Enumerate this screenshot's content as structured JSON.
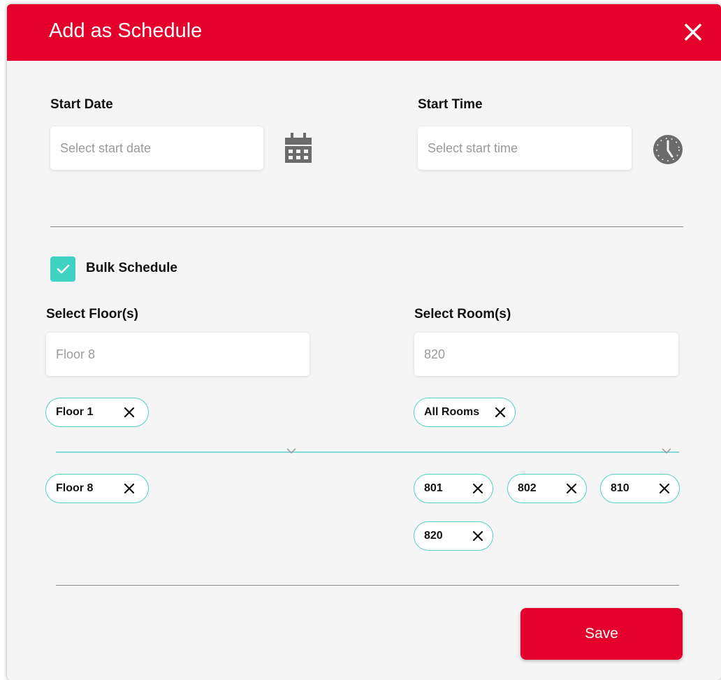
{
  "header": {
    "title": "Add as Schedule",
    "close_icon": "close-icon",
    "color": "#e4002b"
  },
  "start_date": {
    "label": "Start Date",
    "placeholder": "Select start date",
    "icon": "calendar-icon"
  },
  "start_time": {
    "label": "Start Time",
    "placeholder": "Select start time",
    "icon": "clock-icon"
  },
  "bulk": {
    "label": "Bulk Schedule",
    "checked": true,
    "color": "#3fd1c2"
  },
  "floors": {
    "label": "Select Floor(s)",
    "input_value": "Floor 8",
    "selected_top": [
      "Floor 1"
    ],
    "selected_bottom": [
      "Floor 8"
    ]
  },
  "rooms": {
    "label": "Select Room(s)",
    "input_value": "820",
    "selected_top": [
      "All Rooms"
    ],
    "selected_bottom": [
      "801",
      "802",
      "810",
      "820"
    ]
  },
  "footer": {
    "save_label": "Save"
  }
}
